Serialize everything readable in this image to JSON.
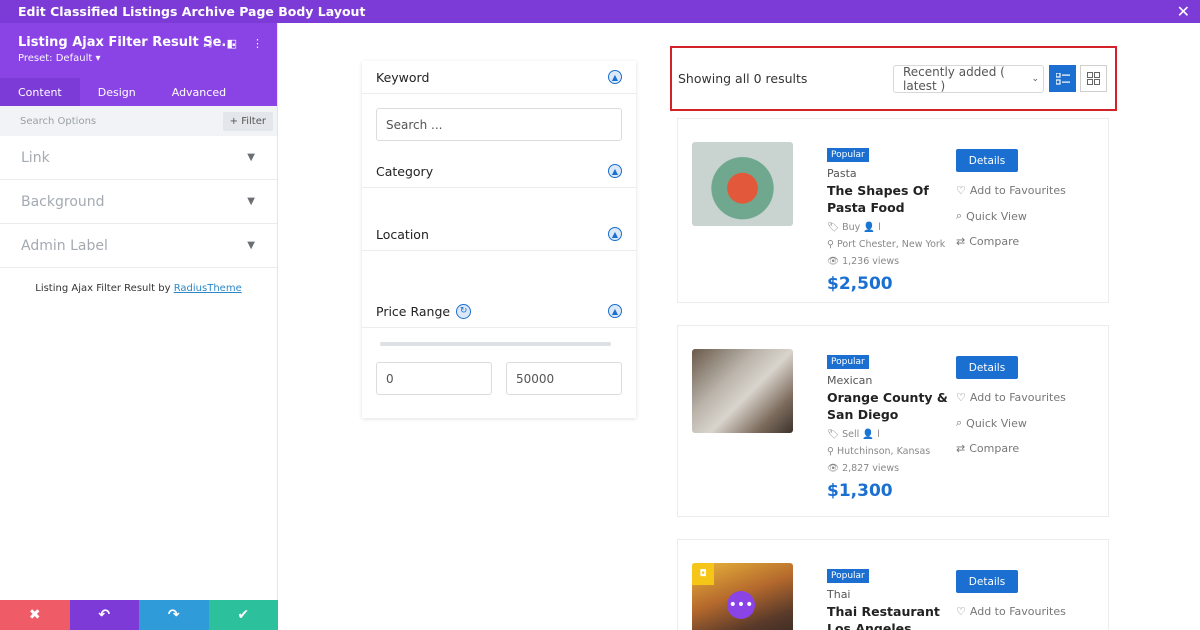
{
  "topbar": {
    "title": "Edit Classified Listings Archive Page Body Layout",
    "close": "✕"
  },
  "panel": {
    "title": "Listing Ajax Filter Result Se...",
    "preset": "Preset: Default ▾",
    "tabs": [
      "Content",
      "Design",
      "Advanced"
    ],
    "search_placeholder": "Search Options",
    "filter_label": "+ Filter",
    "sections": [
      "Link",
      "Background",
      "Admin Label"
    ],
    "credit_prefix": "Listing Ajax Filter Result by",
    "credit_link": "RadiusTheme"
  },
  "filter": {
    "keyword_label": "Keyword",
    "search_placeholder": "Search ...",
    "category_label": "Category",
    "location_label": "Location",
    "price_label": "Price Range",
    "price_min": "0",
    "price_max": "50000"
  },
  "results": {
    "count": "Showing all 0 results",
    "sort": "Recently added ( latest )"
  },
  "listings": [
    {
      "badge": "Popular",
      "category": "Pasta",
      "title": "The Shapes Of Pasta Food",
      "type": "Buy",
      "author": "l",
      "location": "Port Chester, New York",
      "views": "1,236 views",
      "price": "$2,500",
      "details": "Details",
      "favourite": "Add to Favourites",
      "quick_view": "Quick View",
      "compare": "Compare"
    },
    {
      "badge": "Popular",
      "category": "Mexican",
      "title": "Orange County & San Diego",
      "type": "Sell",
      "author": "l",
      "location": "Hutchinson, Kansas",
      "views": "2,827 views",
      "price": "$1,300",
      "details": "Details",
      "favourite": "Add to Favourites",
      "quick_view": "Quick View",
      "compare": "Compare"
    },
    {
      "badge": "Popular",
      "category": "Thai",
      "title": "Thai Restaurant Los Angeles",
      "details": "Details",
      "favourite": "Add to Favourites"
    }
  ],
  "colors": {
    "purple": "#7c3ad6",
    "blue": "#1a6fd0",
    "highlight": "#d32228"
  }
}
